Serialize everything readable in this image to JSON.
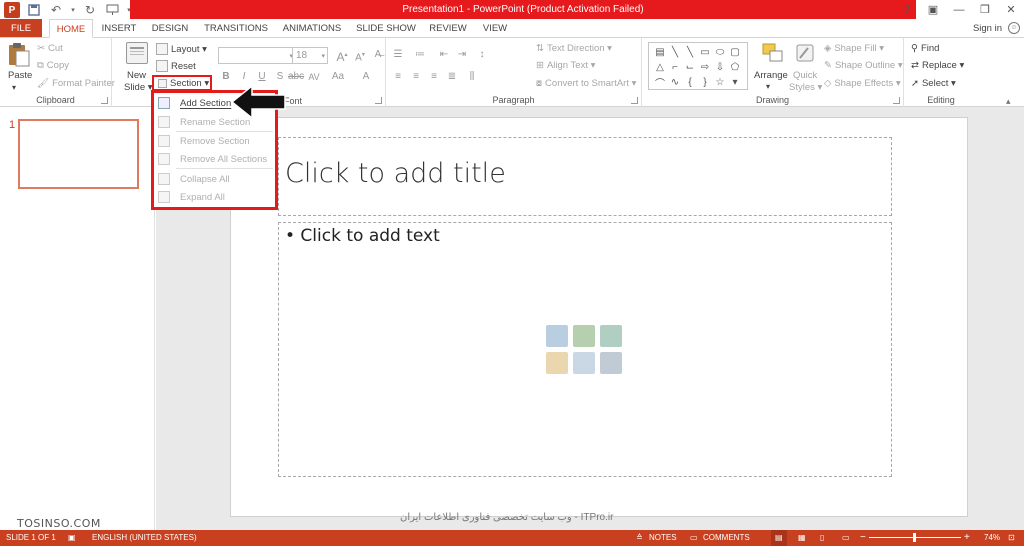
{
  "window": {
    "title": "Presentation1 -  PowerPoint (Product Activation Failed)",
    "controls": [
      "?",
      "▣",
      "—",
      "❐",
      "✕"
    ]
  },
  "qat": {
    "app_icon_label": "P"
  },
  "tabs": [
    {
      "label": "FILE"
    },
    {
      "label": "HOME"
    },
    {
      "label": "INSERT"
    },
    {
      "label": "DESIGN"
    },
    {
      "label": "TRANSITIONS"
    },
    {
      "label": "ANIMATIONS"
    },
    {
      "label": "SLIDE SHOW"
    },
    {
      "label": "REVIEW"
    },
    {
      "label": "VIEW"
    }
  ],
  "signin": "Sign in",
  "ribbon": {
    "clipboard": {
      "label": "Clipboard",
      "paste": "Paste",
      "cut": "Cut",
      "copy": "Copy",
      "format_painter": "Format Painter"
    },
    "slides": {
      "new_slide_1": "New",
      "new_slide_2": "Slide ▾",
      "layout": "Layout ▾",
      "reset": "Reset",
      "section": "Section ▾"
    },
    "font": {
      "label": "Font",
      "size": "18"
    },
    "paragraph": {
      "label": "Paragraph",
      "text_direction": "Text Direction ▾",
      "align_text": "Align Text ▾",
      "convert_smartart": "Convert to SmartArt ▾"
    },
    "drawing": {
      "label": "Drawing",
      "arrange": "Arrange",
      "quick_styles_1": "Quick",
      "quick_styles_2": "Styles ▾",
      "shape_fill": "Shape Fill ▾",
      "shape_outline": "Shape Outline ▾",
      "shape_effects": "Shape Effects ▾"
    },
    "editing": {
      "label": "Editing",
      "find": "Find",
      "replace": "Replace ▾",
      "select": "Select ▾"
    }
  },
  "section_menu": [
    {
      "label": "Add Section",
      "enabled": true
    },
    {
      "label": "Rename Section",
      "enabled": false
    },
    {
      "label": "Remove Section",
      "enabled": false
    },
    {
      "label": "Remove All Sections",
      "enabled": false
    },
    {
      "label": "Collapse All",
      "enabled": false
    },
    {
      "label": "Expand All",
      "enabled": false
    }
  ],
  "thumbnails": {
    "number": "1"
  },
  "slide": {
    "title_placeholder": "Click to add title",
    "body_placeholder": "• Click to add text"
  },
  "watermarks": {
    "left": "TOSINSO.COM",
    "middle": "وب سایت تخصصی فناوری اطلاعات ایران - ITPro.ir"
  },
  "status": {
    "slide": "SLIDE 1 OF 1",
    "language": "ENGLISH (UNITED STATES)",
    "notes": "NOTES",
    "comments": "COMMENTS",
    "zoom": "74%",
    "zoom_minus": "−",
    "zoom_plus": "+"
  },
  "colors": {
    "accent": "#c8401f",
    "title_bar_red": "#e6191c",
    "highlight": "#e31b1b"
  }
}
